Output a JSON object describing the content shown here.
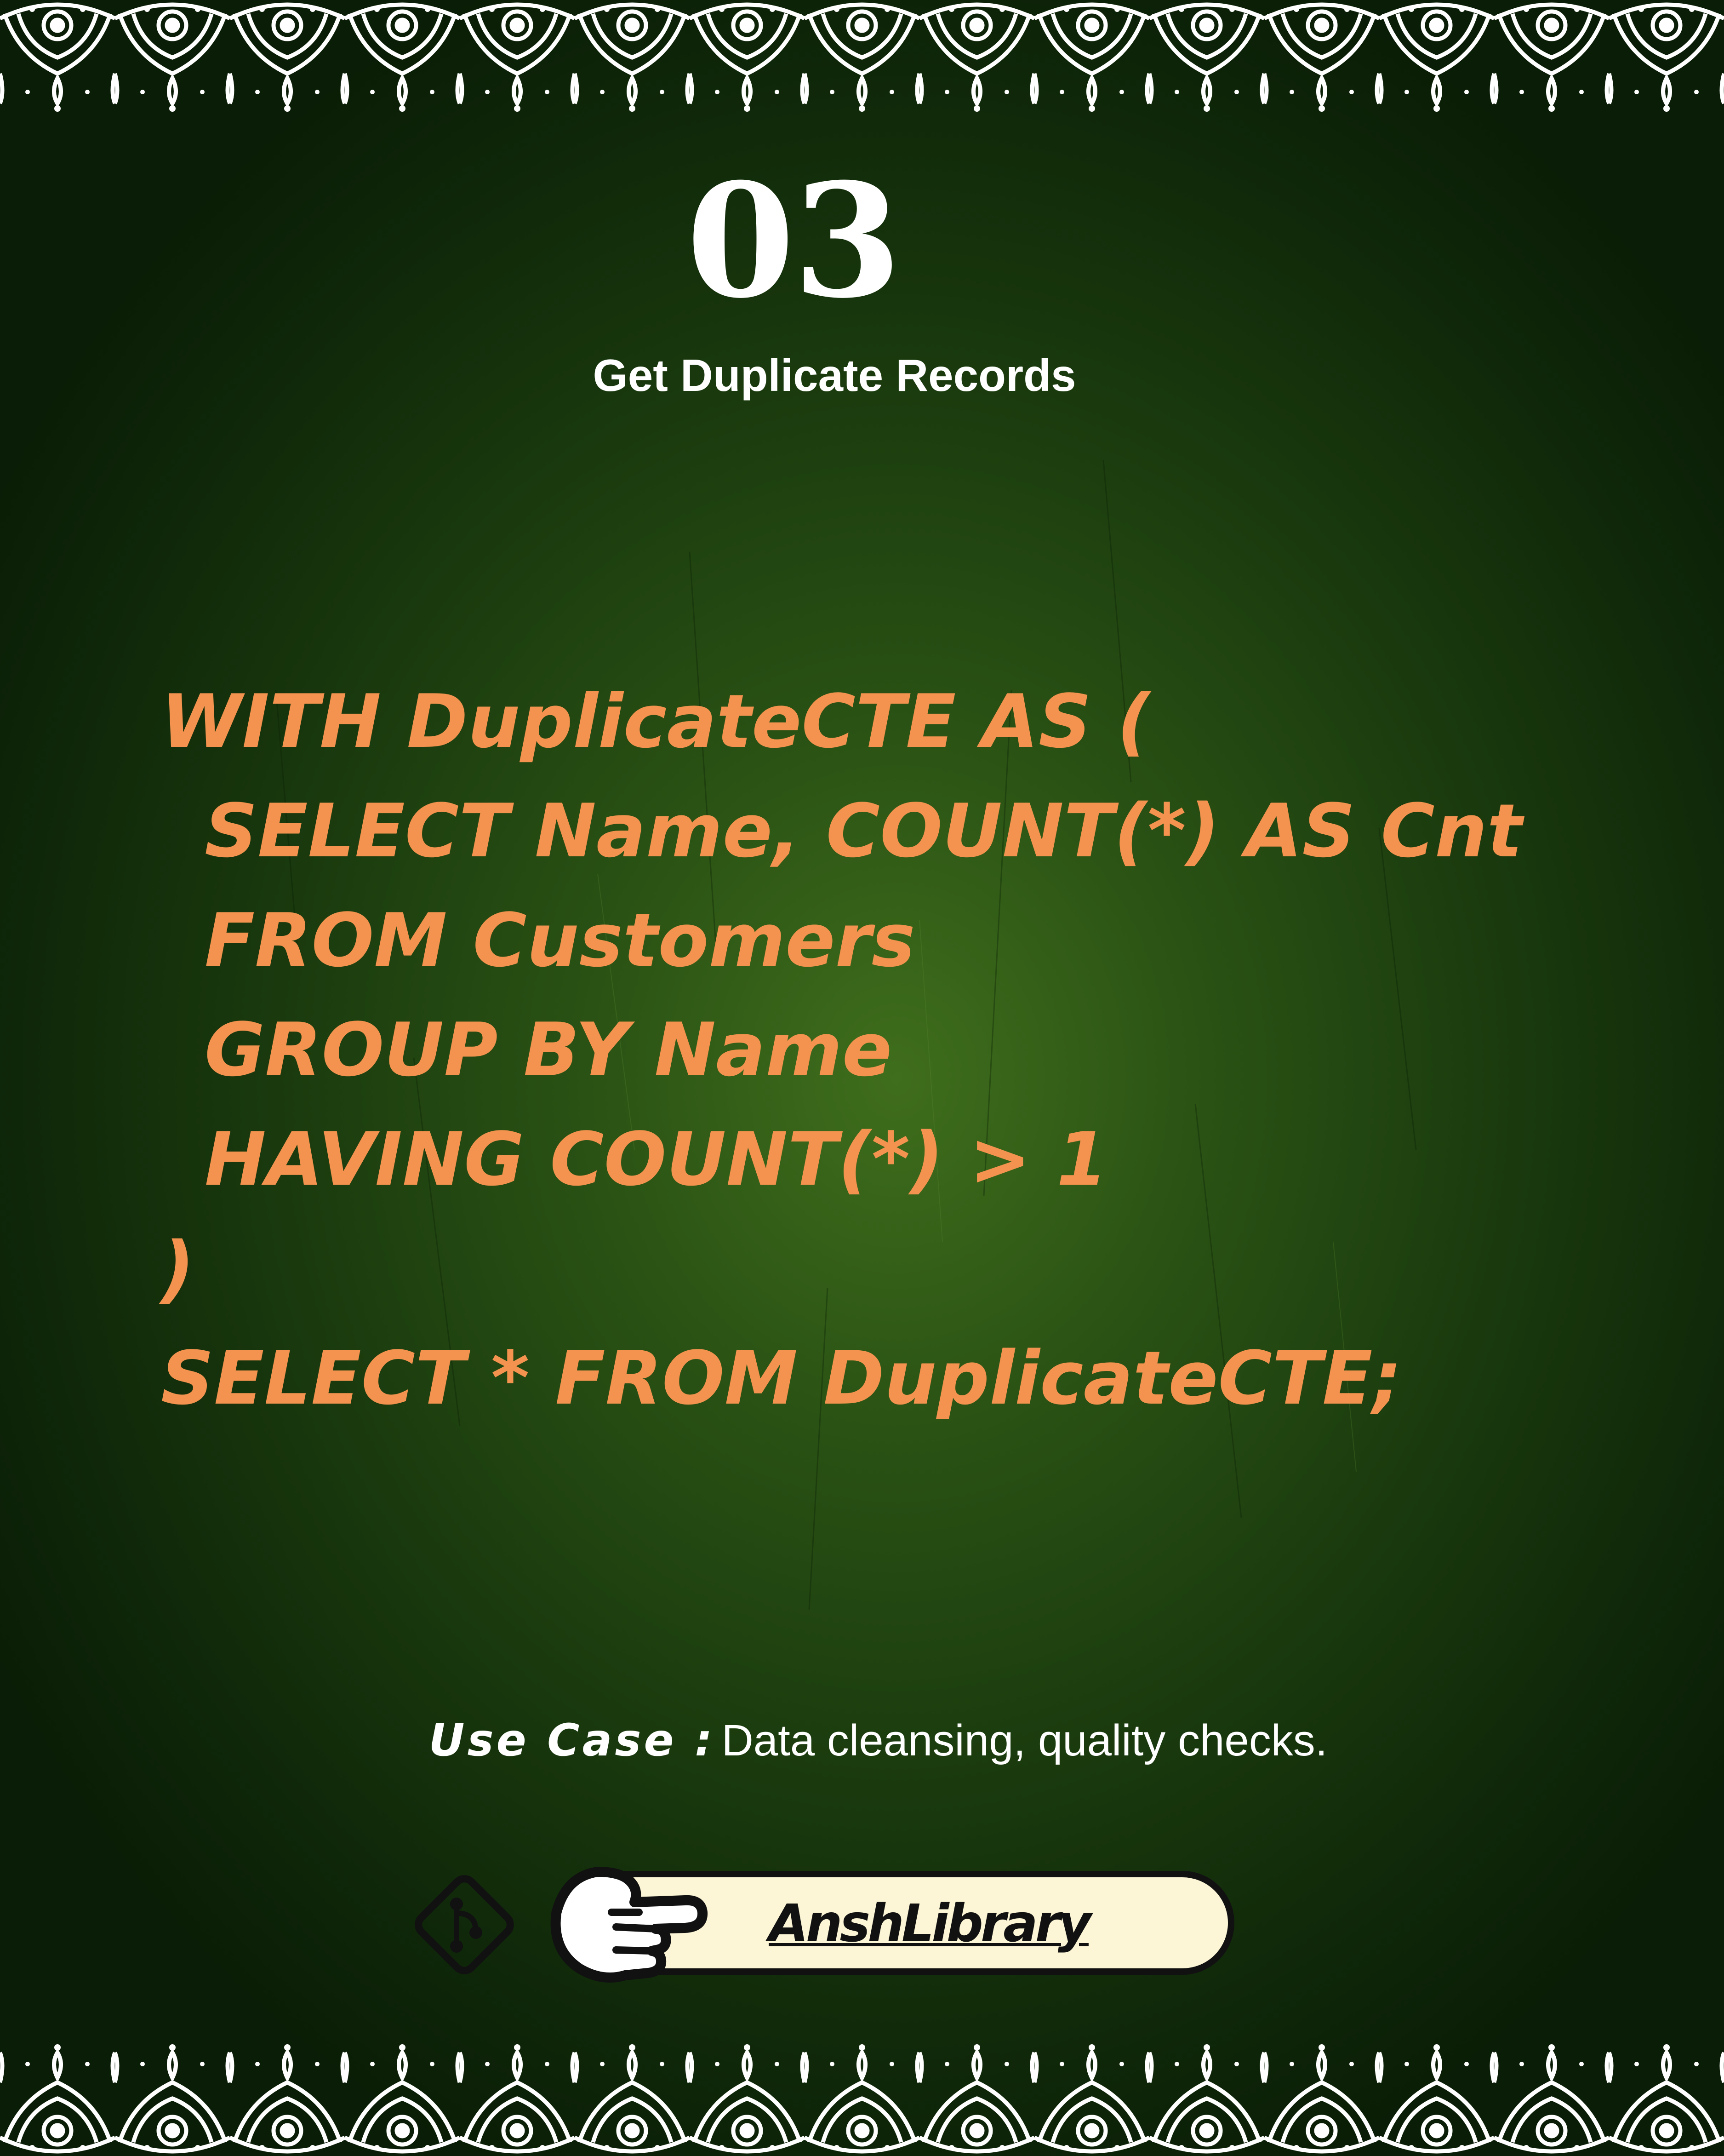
{
  "slide": {
    "number": "03",
    "title": "Get Duplicate Records"
  },
  "code": {
    "lines": [
      "WITH DuplicateCTE AS (",
      "SELECT Name, COUNT(*) AS Cnt",
      "FROM Customers",
      "GROUP BY Name",
      "HAVING COUNT(*) > 1",
      ")",
      "SELECT * FROM DuplicateCTE;"
    ]
  },
  "use_case": {
    "label": "Use Case :",
    "text": "Data cleansing, quality checks."
  },
  "footer": {
    "brand": "AnshLibrary",
    "icons": [
      "git-diamond-icon",
      "pointing-hand-icon"
    ]
  },
  "colors": {
    "background": "#1e4210",
    "code": "#f4934f",
    "text": "#ffffff",
    "pill": "#fcf6d6"
  }
}
